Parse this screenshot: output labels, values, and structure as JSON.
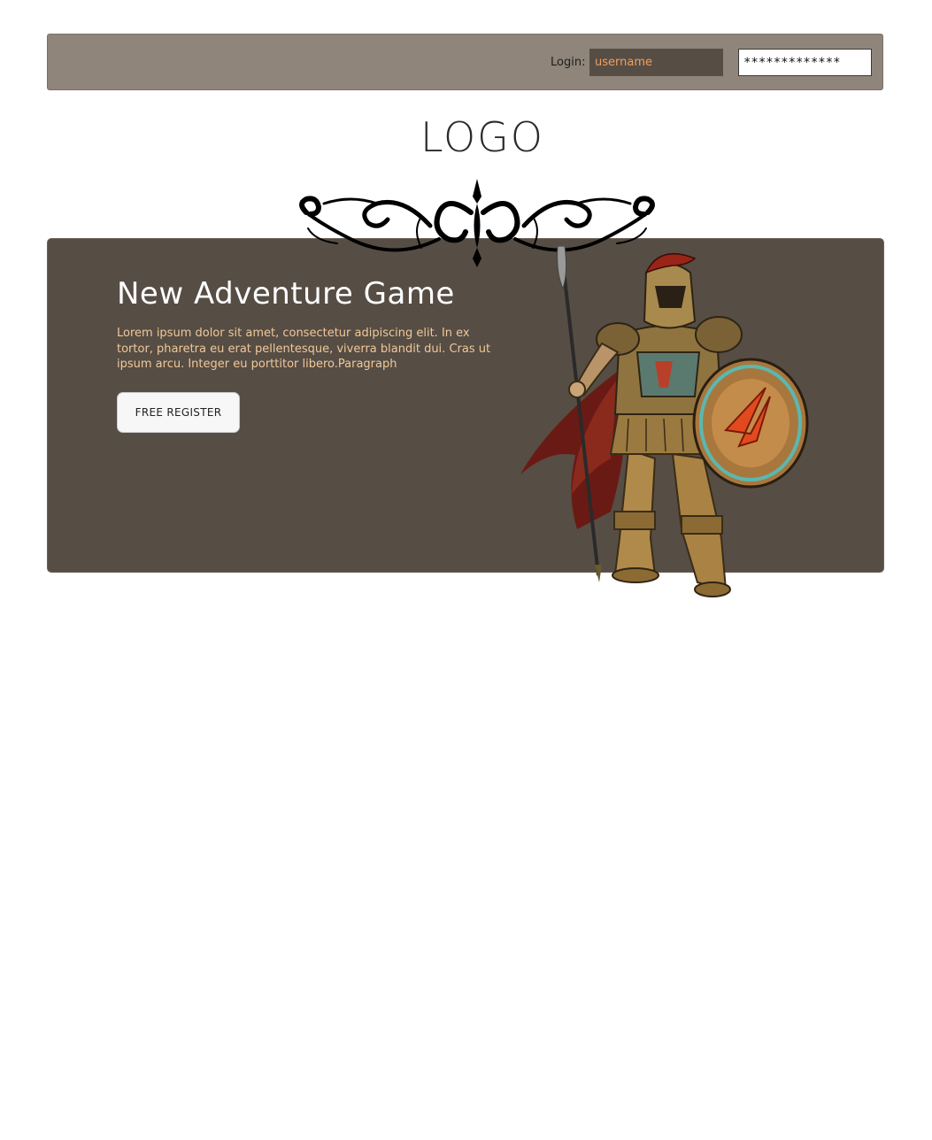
{
  "header": {
    "login_label": "Login:",
    "username_placeholder": "username",
    "password_value": "*************"
  },
  "logo": {
    "text": "LOGO"
  },
  "hero": {
    "title": "New Adventure Game",
    "description": "Lorem ipsum dolor sit amet, consectetur adipiscing elit. In ex tortor, pharetra eu erat pellentesque, viverra blandit dui. Cras ut ipsum arcu. Integer eu porttitor libero.Paragraph",
    "register_label": "FREE REGISTER"
  },
  "colors": {
    "login_bar_bg": "#8f857a",
    "hero_bg": "#564d44",
    "hero_text": "#f0c89a",
    "username_text": "#f0a05a"
  },
  "icons": {
    "ornament": "decorative-flourish",
    "hero_image": "spartan-warrior"
  }
}
